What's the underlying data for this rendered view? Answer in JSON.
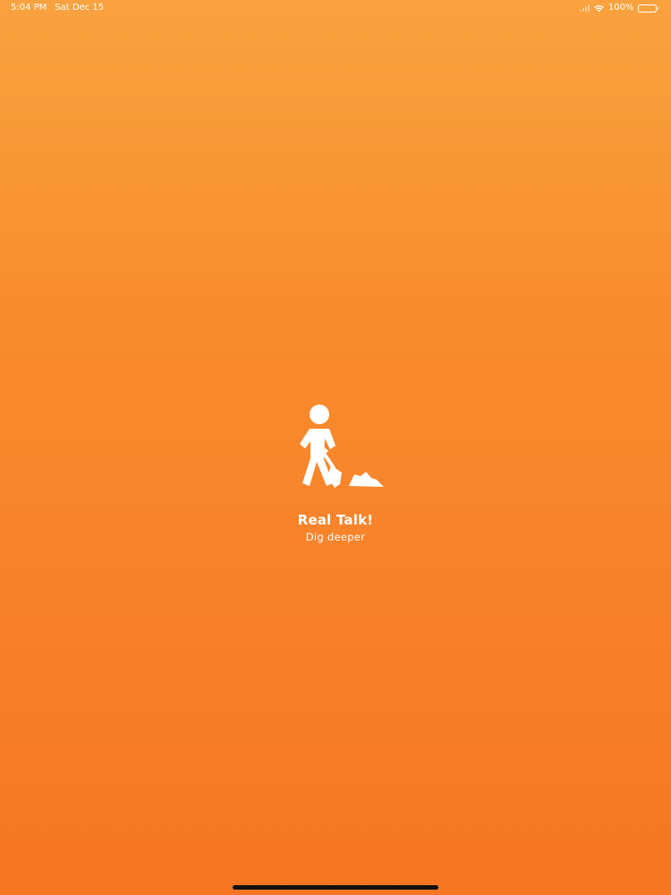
{
  "status_bar": {
    "time": "5:04 PM",
    "date": "Sat Dec 15",
    "battery_percent": "100%",
    "battery_level": 1.0,
    "icons": [
      "signal-icon",
      "wifi-icon",
      "battery-icon"
    ]
  },
  "splash": {
    "icon": "person-digging-icon",
    "title": "Real Talk!",
    "subtitle": "Dig deeper"
  },
  "colors": {
    "background_top": "#f9a23f",
    "background_bottom": "#f77523",
    "foreground": "#ffffff",
    "home_indicator": "#111111"
  }
}
